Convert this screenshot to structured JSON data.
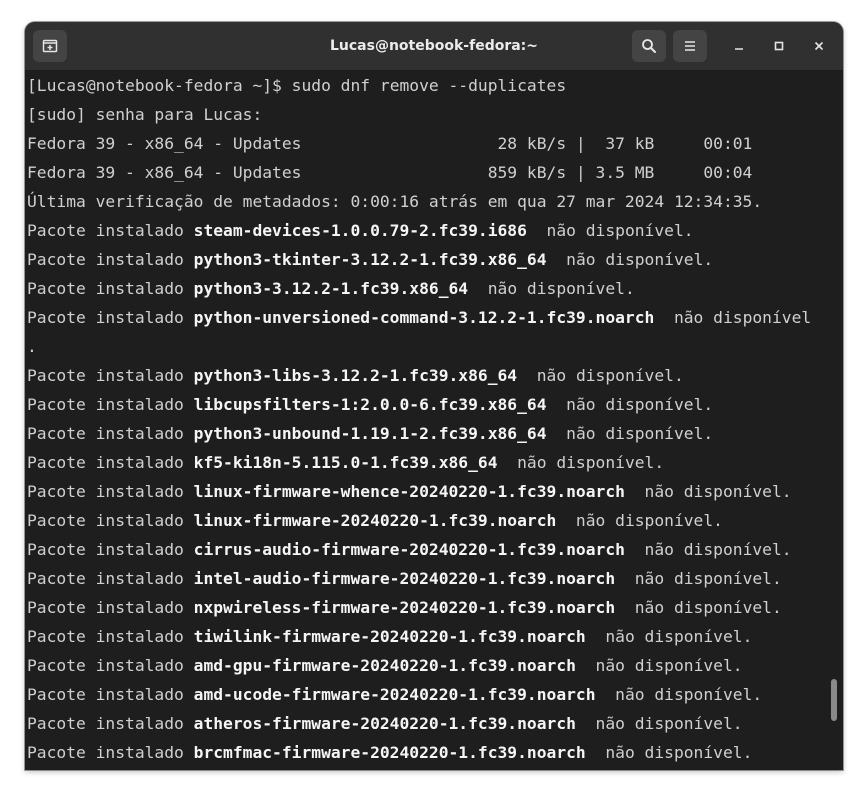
{
  "window": {
    "title": "Lucas@notebook-fedora:~",
    "icons": {
      "new_tab": "new-tab-icon",
      "search": "search-icon",
      "menu": "hamburger-menu-icon",
      "minimize": "minimize-icon",
      "maximize": "maximize-icon",
      "close": "close-icon"
    }
  },
  "terminal": {
    "prompt": "[Lucas@notebook-fedora ~]$ ",
    "command": "sudo dnf remove --duplicates",
    "sudo_prompt": "[sudo] senha para Lucas:",
    "repo_lines": [
      "Fedora 39 - x86_64 - Updates                    28 kB/s |  37 kB     00:01",
      "Fedora 39 - x86_64 - Updates                   859 kB/s | 3.5 MB     00:04"
    ],
    "metadata_line": "Última verificação de metadados: 0:00:16 atrás em qua 27 mar 2024 12:34:35.",
    "package_prefix": "Pacote instalado ",
    "packages": [
      {
        "name": "steam-devices-1.0.0.79-2.fc39.i686",
        "status": "  não disponível."
      },
      {
        "name": "python3-tkinter-3.12.2-1.fc39.x86_64",
        "status": "  não disponível."
      },
      {
        "name": "python3-3.12.2-1.fc39.x86_64",
        "status": "  não disponível."
      },
      {
        "name": "python-unversioned-command-3.12.2-1.fc39.noarch",
        "status": "  não disponível",
        "wrap": "."
      },
      {
        "name": "python3-libs-3.12.2-1.fc39.x86_64",
        "status": "  não disponível."
      },
      {
        "name": "libcupsfilters-1:2.0.0-6.fc39.x86_64",
        "status": "  não disponível."
      },
      {
        "name": "python3-unbound-1.19.1-2.fc39.x86_64",
        "status": "  não disponível."
      },
      {
        "name": "kf5-ki18n-5.115.0-1.fc39.x86_64",
        "status": "  não disponível."
      },
      {
        "name": "linux-firmware-whence-20240220-1.fc39.noarch",
        "status": "  não disponível."
      },
      {
        "name": "linux-firmware-20240220-1.fc39.noarch",
        "status": "  não disponível."
      },
      {
        "name": "cirrus-audio-firmware-20240220-1.fc39.noarch",
        "status": "  não disponível."
      },
      {
        "name": "intel-audio-firmware-20240220-1.fc39.noarch",
        "status": "  não disponível."
      },
      {
        "name": "nxpwireless-firmware-20240220-1.fc39.noarch",
        "status": "  não disponível."
      },
      {
        "name": "tiwilink-firmware-20240220-1.fc39.noarch",
        "status": "  não disponível."
      },
      {
        "name": "amd-gpu-firmware-20240220-1.fc39.noarch",
        "status": "  não disponível."
      },
      {
        "name": "amd-ucode-firmware-20240220-1.fc39.noarch",
        "status": "  não disponível."
      },
      {
        "name": "atheros-firmware-20240220-1.fc39.noarch",
        "status": "  não disponível."
      },
      {
        "name": "brcmfmac-firmware-20240220-1.fc39.noarch",
        "status": "  não disponível."
      }
    ],
    "colors": {
      "background": "#1e1e1e",
      "text": "#d0d0d0",
      "bold_text": "#f5f5f5",
      "titlebar": "#303030"
    }
  }
}
